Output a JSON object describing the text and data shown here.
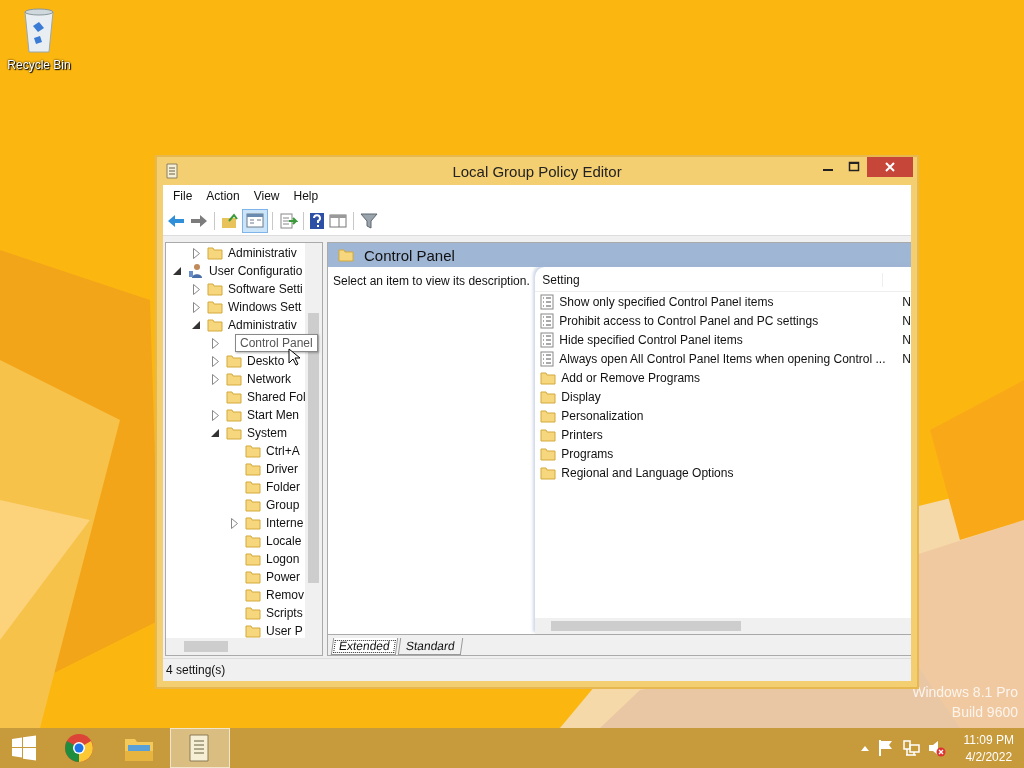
{
  "desktop": {
    "icons": [
      {
        "label": "Recycle Bin",
        "kind": "recycle"
      }
    ],
    "watermark": [
      "Windows 8.1 Pro",
      "Build 9600"
    ]
  },
  "window": {
    "title": "Local Group Policy Editor"
  },
  "menu": [
    "File",
    "Action",
    "View",
    "Help"
  ],
  "toolbar": [
    {
      "kind": "back"
    },
    {
      "kind": "forward"
    },
    {
      "kind": "sep"
    },
    {
      "kind": "up"
    },
    {
      "kind": "tree",
      "selected": true
    },
    {
      "kind": "sep"
    },
    {
      "kind": "export"
    },
    {
      "kind": "sep"
    },
    {
      "kind": "help"
    },
    {
      "kind": "view"
    },
    {
      "kind": "sep"
    },
    {
      "kind": "filter"
    }
  ],
  "tree": [
    {
      "children": [
        {
          "label": "Administrativ",
          "kind": "folder",
          "expanded": false,
          "hovered": false
        }
      ]
    },
    {
      "label": "User Configuratio",
      "kind": "user",
      "expanded": true,
      "hovered": false,
      "children": [
        {
          "label": "Software Setti",
          "kind": "folder",
          "expanded": false,
          "hovered": false
        },
        {
          "label": "Windows Sett",
          "kind": "folder",
          "expanded": false,
          "hovered": false
        },
        {
          "label": "Administrativ",
          "kind": "folder",
          "expanded": true,
          "hovered": false,
          "children": [
            {
              "label": "Control Panel",
              "kind": "folder",
              "expanded": false,
              "hovered": true
            },
            {
              "label": "Deskto",
              "kind": "folder",
              "expanded": false,
              "hovered": false
            },
            {
              "label": "Network",
              "kind": "folder",
              "expanded": false,
              "hovered": false
            },
            {
              "label": "Shared Fol",
              "kind": "folder",
              "hovered": false
            },
            {
              "label": "Start Men",
              "kind": "folder",
              "expanded": false,
              "hovered": false
            },
            {
              "label": "System",
              "kind": "folder",
              "expanded": true,
              "hovered": false,
              "children": [
                {
                  "label": "Ctrl+A",
                  "kind": "folder",
                  "hovered": false
                },
                {
                  "label": "Driver",
                  "kind": "folder",
                  "hovered": false
                },
                {
                  "label": "Folder",
                  "kind": "folder",
                  "hovered": false
                },
                {
                  "label": "Group",
                  "kind": "folder",
                  "hovered": false
                },
                {
                  "label": "Interne",
                  "kind": "folder",
                  "expanded": false,
                  "hovered": false
                },
                {
                  "label": "Locale",
                  "kind": "folder",
                  "hovered": false
                },
                {
                  "label": "Logon",
                  "kind": "folder",
                  "hovered": false
                },
                {
                  "label": "Power",
                  "kind": "folder",
                  "hovered": false
                },
                {
                  "label": "Remov",
                  "kind": "folder",
                  "hovered": false
                },
                {
                  "label": "Scripts",
                  "kind": "folder",
                  "hovered": false
                },
                {
                  "label": "User P",
                  "kind": "folder",
                  "hovered": false
                }
              ]
            }
          ]
        }
      ]
    }
  ],
  "details": {
    "title": "Control Panel",
    "description": "Select an item to view its description.",
    "columns": [
      "Setting"
    ],
    "rows": [
      {
        "kind": "setting",
        "name": "Show only specified Control Panel items",
        "column_2": "N"
      },
      {
        "kind": "setting",
        "name": "Prohibit access to Control Panel and PC settings",
        "column_2": "N"
      },
      {
        "kind": "setting",
        "name": "Hide specified Control Panel items",
        "column_2": "N"
      },
      {
        "kind": "setting",
        "name": "Always open All Control Panel Items when opening Control ...",
        "column_2": "N"
      },
      {
        "kind": "folder",
        "name": "Add or Remove Programs"
      },
      {
        "kind": "folder",
        "name": "Display"
      },
      {
        "kind": "folder",
        "name": "Personalization"
      },
      {
        "kind": "folder",
        "name": "Printers"
      },
      {
        "kind": "folder",
        "name": "Programs"
      },
      {
        "kind": "folder",
        "name": "Regional and Language Options"
      }
    ],
    "tabs": [
      {
        "label": "Extended",
        "selected": true
      },
      {
        "label": "Standard",
        "selected": false
      }
    ]
  },
  "status_bar": "4 setting(s)",
  "taskbar": {
    "apps": [
      {
        "kind": "browser",
        "selected": false
      },
      {
        "kind": "explorer",
        "selected": false
      },
      {
        "kind": "document",
        "selected": true
      }
    ],
    "tray": [
      {
        "kind": "caret"
      },
      {
        "kind": "flag"
      },
      {
        "kind": "network"
      },
      {
        "kind": "speaker-muted"
      }
    ],
    "time": "11:09 PM",
    "date": "4/2/2022"
  }
}
